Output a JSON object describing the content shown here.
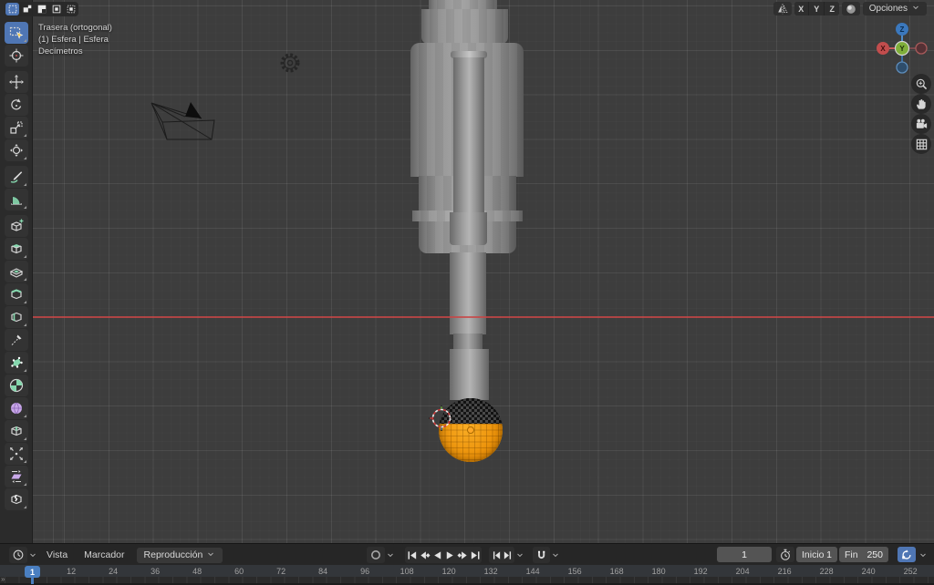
{
  "view_info": {
    "view": "Trasera (ortogonal)",
    "object": "(1) Esfera | Esfera",
    "units": "Decímetros"
  },
  "header": {
    "selection_modes": [
      {
        "name": "set",
        "active": true
      },
      {
        "name": "extend",
        "active": false
      },
      {
        "name": "subtract",
        "active": false
      },
      {
        "name": "invert",
        "active": false
      },
      {
        "name": "intersect",
        "active": false
      }
    ],
    "mirror": {
      "icon": "mirror-butterfly",
      "axes": [
        "X",
        "Y",
        "Z"
      ]
    },
    "falloff_icon": "falloff-sphere",
    "options_label": "Opciones"
  },
  "toolbar": {
    "active_tool": "select-box",
    "tools": [
      {
        "name": "select-box",
        "group": 1,
        "active": true
      },
      {
        "name": "cursor",
        "group": 1,
        "active": false
      },
      {
        "name": "move",
        "group": 2,
        "active": false
      },
      {
        "name": "rotate",
        "group": 2,
        "active": false
      },
      {
        "name": "scale",
        "group": 2,
        "active": false
      },
      {
        "name": "transform",
        "group": 2,
        "active": false
      },
      {
        "name": "annotate",
        "group": 3,
        "active": false
      },
      {
        "name": "measure",
        "group": 3,
        "active": false
      },
      {
        "name": "add-cube",
        "group": 4,
        "active": false
      },
      {
        "name": "extrude-region",
        "group": 4,
        "active": false
      },
      {
        "name": "inset-faces",
        "group": 4,
        "active": false
      },
      {
        "name": "bevel",
        "group": 4,
        "active": false
      },
      {
        "name": "loop-cut",
        "group": 4,
        "active": false
      },
      {
        "name": "knife",
        "group": 4,
        "active": false
      },
      {
        "name": "poly-build",
        "group": 4,
        "active": false
      },
      {
        "name": "spin",
        "group": 4,
        "active": false
      },
      {
        "name": "smooth",
        "group": 4,
        "active": false
      },
      {
        "name": "edge-slide",
        "group": 4,
        "active": false
      },
      {
        "name": "shrink-fatten",
        "group": 4,
        "active": false
      },
      {
        "name": "shear",
        "group": 4,
        "active": false
      },
      {
        "name": "rip-region",
        "group": 4,
        "active": false
      }
    ]
  },
  "gizmo": {
    "x_label": "X",
    "y_label": "Y",
    "z_label": "Z"
  },
  "nav_buttons": [
    "zoom",
    "pan",
    "camera",
    "grid"
  ],
  "timeline": {
    "editor_icon": "clock",
    "menus": [
      "Vista",
      "Marcador"
    ],
    "playback_menu": "Reproducción",
    "record_icon": "record-circle",
    "transport": [
      "jump-start",
      "prev-keyframe",
      "play-reverse",
      "play",
      "next-keyframe",
      "jump-end"
    ],
    "nudge": [
      "step-back",
      "step-forward"
    ],
    "snap_icon": "magnet",
    "current_frame": "1",
    "start_label": "Inicio",
    "start_value": "1",
    "end_label": "Fin",
    "end_value": "250",
    "playhead_frame": "1",
    "ruler_ticks": [
      12,
      24,
      36,
      48,
      60,
      72,
      84,
      96,
      108,
      120,
      132,
      144,
      156,
      168,
      180,
      192,
      204,
      216,
      228,
      240,
      252
    ]
  },
  "colors": {
    "accent_blue": "#4f76b4",
    "selection_orange": "#ef9912",
    "axis_red": "#c24d4d",
    "axis_blue": "#3b78bd",
    "axis_green": "#7fae3a",
    "tool_mint": "#86d7ae",
    "tool_purple": "#c8a8e8"
  }
}
